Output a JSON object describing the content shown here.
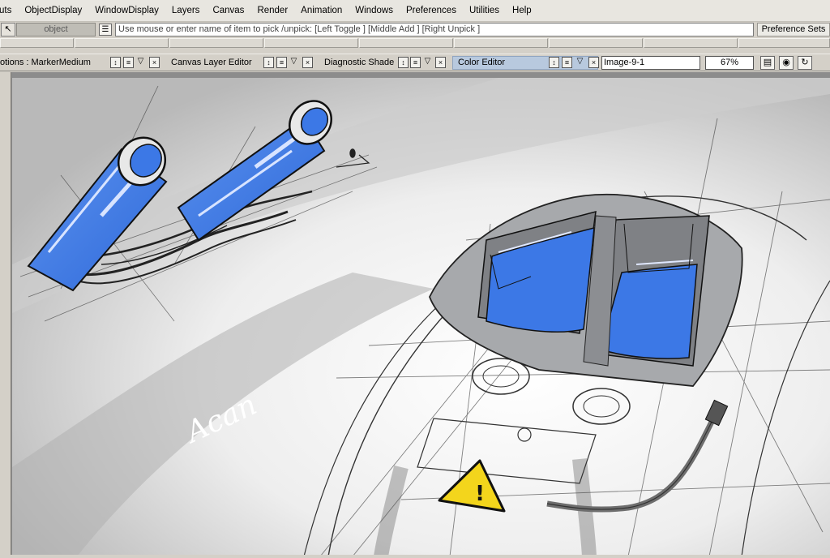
{
  "menu": [
    "uts",
    "ObjectDisplay",
    "WindowDisplay",
    "Layers",
    "Canvas",
    "Render",
    "Animation",
    "Windows",
    "Preferences",
    "Utilities",
    "Help"
  ],
  "pickrow": {
    "object_label": "object",
    "hint_text": "Use mouse or enter name of item to pick /unpick: [Left Toggle ] [Middle Add ] [Right Unpick ]",
    "preference_sets": "Preference Sets"
  },
  "editors": {
    "options": "otions : MarkerMedium",
    "canvas_layer": "Canvas Layer Editor",
    "diagnostic": "Diagnostic Shade",
    "color": "Color Editor"
  },
  "image_name": "Image-9-1",
  "zoom": "67%",
  "icons": {
    "pick_tool": "pick-arrow-icon",
    "hint": "list-icon",
    "panel_controls": [
      "updown-icon",
      "menu-icon",
      "triangle-icon",
      "close-icon"
    ],
    "view_tools": [
      "layout-icon",
      "camera-icon",
      "refresh-icon"
    ]
  },
  "colors": {
    "accent_blue": "#3c78e6",
    "warning_yellow": "#f3d51c",
    "active_tab": "#b8c9de"
  },
  "signature": "Acan",
  "warning_symbol": "!"
}
